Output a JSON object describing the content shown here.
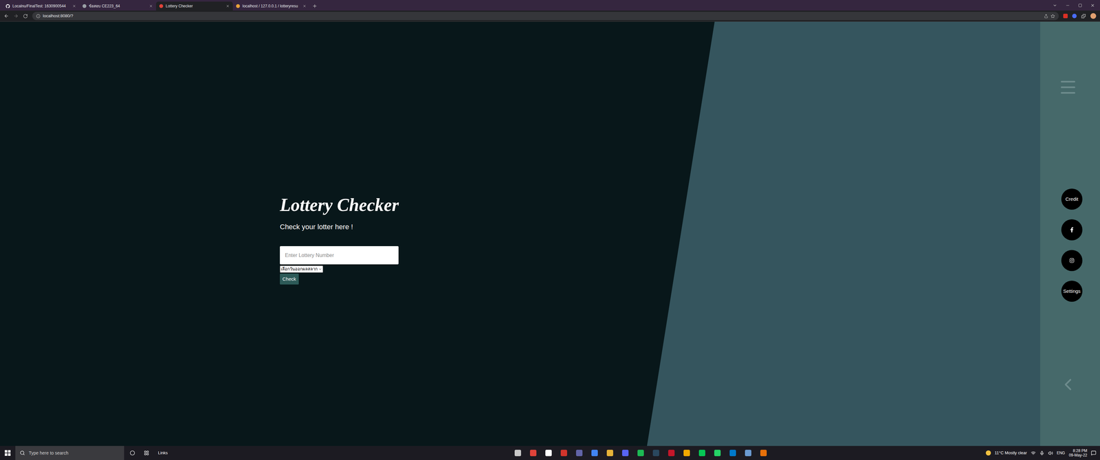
{
  "browser": {
    "tabs": [
      {
        "label": "Localnu/FinalTest: 1630900544",
        "selected": false
      },
      {
        "label": "ข้อสอบ CE223_64",
        "selected": false
      },
      {
        "label": "Lottery Checker",
        "selected": true
      },
      {
        "label": "localhost / 127.0.0.1 / lotteryresu",
        "selected": false
      }
    ],
    "address": "localhost:8080/?"
  },
  "page": {
    "title": "Lottery Checker",
    "subtitle": "Check your lotter here !",
    "input_placeholder": "Enter Lottery Number",
    "select": "เลือกวันออกผลสลาก",
    "button": "Check",
    "side_buttons": [
      {
        "kind": "text",
        "label": "Credit"
      },
      {
        "kind": "facebook",
        "label": ""
      },
      {
        "kind": "instagram",
        "label": ""
      },
      {
        "kind": "text",
        "label": "Settings"
      }
    ]
  },
  "taskbar": {
    "search_placeholder": "Type here to search",
    "links": "Links",
    "weather": "11°C Mostly clear",
    "language": "ENG",
    "time": "8:28 PM",
    "date": "09-May-22"
  }
}
